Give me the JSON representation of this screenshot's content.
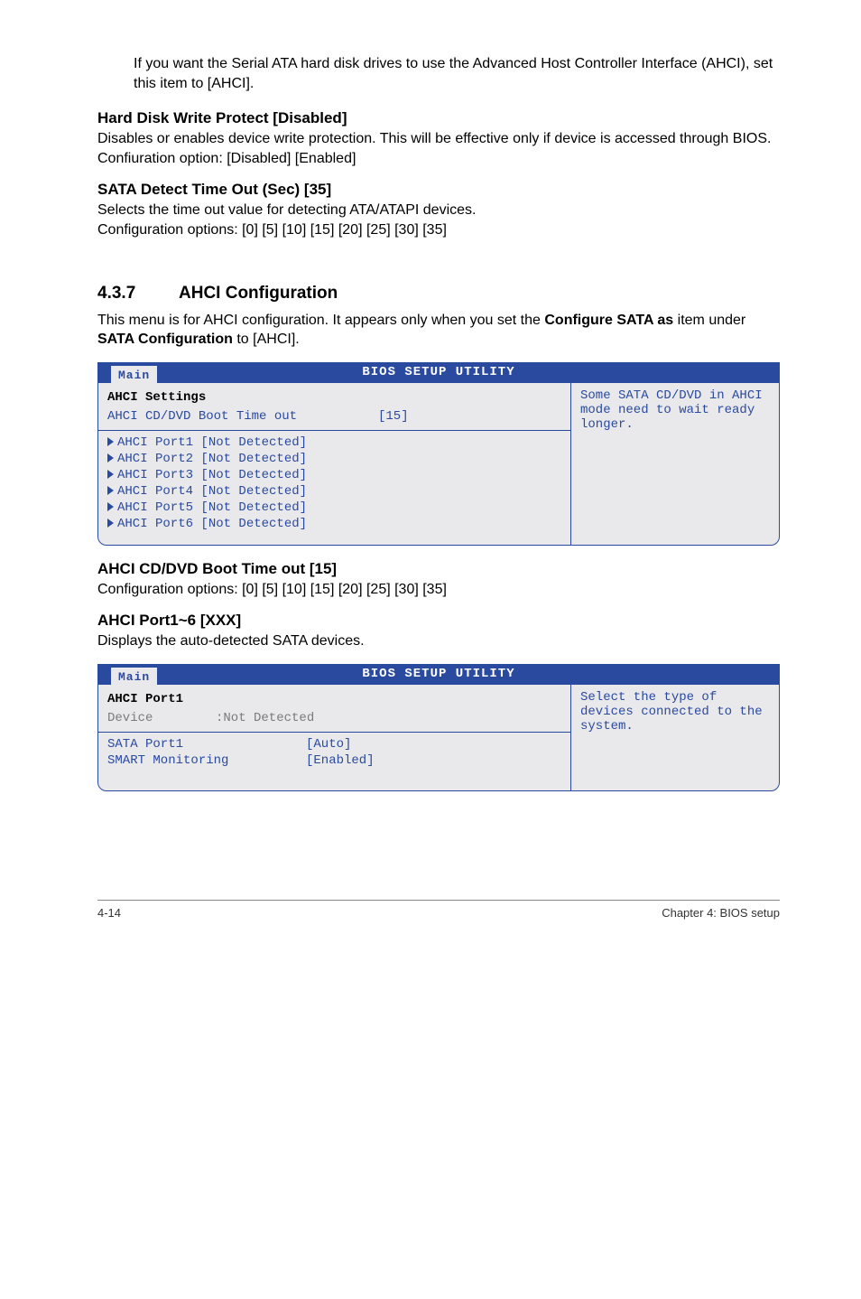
{
  "intro_para": "If you want the Serial ATA hard disk drives to use the Advanced Host Controller Interface (AHCI), set this item to [AHCI].",
  "hd_write": {
    "heading": "Hard Disk Write Protect [Disabled]",
    "body": "Disables or enables device write protection. This will be effective only if device is accessed through BIOS.\nConfiuration option: [Disabled] [Enabled]"
  },
  "sata_detect": {
    "heading": "SATA Detect Time Out (Sec) [35]",
    "body": "Selects the time out value for detecting ATA/ATAPI devices.\nConfiguration options: [0] [5] [10] [15] [20] [25] [30] [35]"
  },
  "section": {
    "num": "4.3.7",
    "title": "AHCI Configuration",
    "intro_a": "This menu is for AHCI configuration. It appears only when you set the ",
    "intro_b": "Configure SATA as",
    "intro_c": " item under ",
    "intro_d": "SATA Configuration",
    "intro_e": " to [AHCI]."
  },
  "bios_common": {
    "title": "BIOS SETUP UTILITY",
    "tab": "Main"
  },
  "bios1": {
    "section_title": "AHCI Settings",
    "row1_label": "AHCI CD/DVD Boot Time out",
    "row1_value": "[15]",
    "ports": [
      "AHCI Port1 [Not Detected]",
      "AHCI Port2 [Not Detected]",
      "AHCI Port3 [Not Detected]",
      "AHCI Port4 [Not Detected]",
      "AHCI Port5 [Not Detected]",
      "AHCI Port6 [Not Detected]"
    ],
    "help": "Some SATA CD/DVD in AHCI mode need to wait ready longer."
  },
  "ahci_boot": {
    "heading": "AHCI CD/DVD Boot Time out [15]",
    "body": "Configuration options: [0] [5] [10] [15] [20] [25] [30] [35]"
  },
  "ahci_port": {
    "heading": "AHCI Port1~6 [XXX]",
    "body": "Displays the auto-detected SATA devices."
  },
  "bios2": {
    "section_title": "AHCI Port1",
    "device_label": "Device",
    "device_value": ":Not Detected",
    "row1_label": "SATA Port1",
    "row1_value": "[Auto]",
    "row2_label": "SMART Monitoring",
    "row2_value": "[Enabled]",
    "help": "Select the type of devices connected to the system."
  },
  "footer": {
    "left": "4-14",
    "right": "Chapter 4: BIOS setup"
  }
}
